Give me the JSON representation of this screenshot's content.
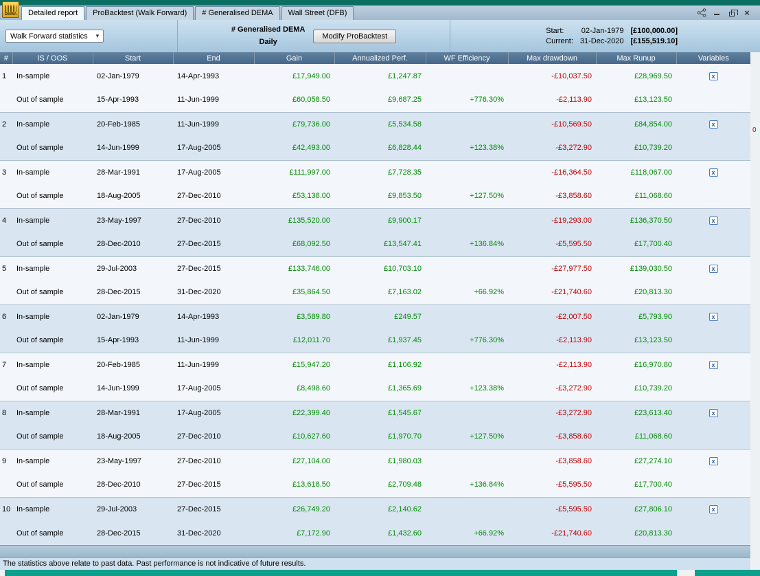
{
  "window": {
    "app_icon_label": "DEMA",
    "tabs": [
      {
        "label": "Detailed report",
        "active": true
      },
      {
        "label": "ProBacktest (Walk Forward)",
        "active": false
      },
      {
        "label": "# Generalised DEMA",
        "active": false
      },
      {
        "label": "Wall Street (DFB)",
        "active": false
      }
    ]
  },
  "icons": {
    "chevron_down": "▾",
    "close": "×",
    "variables_glyph": "x"
  },
  "toolbar": {
    "dropdown_label": "Walk Forward statistics",
    "instrument_title": "# Generalised DEMA",
    "timeframe": "Daily",
    "modify_button": "Modify ProBacktest",
    "start_label": "Start:",
    "start_date": "02-Jan-1979",
    "start_value": "[£100,000.00]",
    "current_label": "Current:",
    "current_date": "31-Dec-2020",
    "current_value": "[£155,519.10]"
  },
  "table": {
    "headers": [
      "#",
      "IS / OOS",
      "Start",
      "End",
      "Gain",
      "Annualized Perf.",
      "WF Efficiency",
      "Max drawdown",
      "Max Runup",
      "Variables"
    ],
    "groups": [
      {
        "num": "1",
        "rows": [
          {
            "type": "In-sample",
            "start": "02-Jan-1979",
            "end": "14-Apr-1993",
            "gain": "£17,949.00",
            "annualized": "£1,247.87",
            "wf": "",
            "drawdown": "-£10,037.50",
            "runup": "£28,969.50"
          },
          {
            "type": "Out of sample",
            "start": "15-Apr-1993",
            "end": "11-Jun-1999",
            "gain": "£60,058.50",
            "annualized": "£9,687.25",
            "wf": "+776.30%",
            "drawdown": "-£2,113.90",
            "runup": "£13,123.50"
          }
        ]
      },
      {
        "num": "2",
        "rows": [
          {
            "type": "In-sample",
            "start": "20-Feb-1985",
            "end": "11-Jun-1999",
            "gain": "£79,736.00",
            "annualized": "£5,534.58",
            "wf": "",
            "drawdown": "-£10,569.50",
            "runup": "£84,854.00"
          },
          {
            "type": "Out of sample",
            "start": "14-Jun-1999",
            "end": "17-Aug-2005",
            "gain": "£42,493.00",
            "annualized": "£6,828.44",
            "wf": "+123.38%",
            "drawdown": "-£3,272.90",
            "runup": "£10,739.20"
          }
        ]
      },
      {
        "num": "3",
        "rows": [
          {
            "type": "In-sample",
            "start": "28-Mar-1991",
            "end": "17-Aug-2005",
            "gain": "£111,997.00",
            "annualized": "£7,728.35",
            "wf": "",
            "drawdown": "-£16,364.50",
            "runup": "£118,067.00"
          },
          {
            "type": "Out of sample",
            "start": "18-Aug-2005",
            "end": "27-Dec-2010",
            "gain": "£53,138.00",
            "annualized": "£9,853.50",
            "wf": "+127.50%",
            "drawdown": "-£3,858.60",
            "runup": "£11,068.60"
          }
        ]
      },
      {
        "num": "4",
        "rows": [
          {
            "type": "In-sample",
            "start": "23-May-1997",
            "end": "27-Dec-2010",
            "gain": "£135,520.00",
            "annualized": "£9,900.17",
            "wf": "",
            "drawdown": "-£19,293.00",
            "runup": "£136,370.50"
          },
          {
            "type": "Out of sample",
            "start": "28-Dec-2010",
            "end": "27-Dec-2015",
            "gain": "£68,092.50",
            "annualized": "£13,547.41",
            "wf": "+136.84%",
            "drawdown": "-£5,595.50",
            "runup": "£17,700.40"
          }
        ]
      },
      {
        "num": "5",
        "rows": [
          {
            "type": "In-sample",
            "start": "29-Jul-2003",
            "end": "27-Dec-2015",
            "gain": "£133,746.00",
            "annualized": "£10,703.10",
            "wf": "",
            "drawdown": "-£27,977.50",
            "runup": "£139,030.50"
          },
          {
            "type": "Out of sample",
            "start": "28-Dec-2015",
            "end": "31-Dec-2020",
            "gain": "£35,864.50",
            "annualized": "£7,163.02",
            "wf": "+66.92%",
            "drawdown": "-£21,740.60",
            "runup": "£20,813.30"
          }
        ]
      },
      {
        "num": "6",
        "rows": [
          {
            "type": "In-sample",
            "start": "02-Jan-1979",
            "end": "14-Apr-1993",
            "gain": "£3,589.80",
            "annualized": "£249.57",
            "wf": "",
            "drawdown": "-£2,007.50",
            "runup": "£5,793.90"
          },
          {
            "type": "Out of sample",
            "start": "15-Apr-1993",
            "end": "11-Jun-1999",
            "gain": "£12,011.70",
            "annualized": "£1,937.45",
            "wf": "+776.30%",
            "drawdown": "-£2,113.90",
            "runup": "£13,123.50"
          }
        ]
      },
      {
        "num": "7",
        "rows": [
          {
            "type": "In-sample",
            "start": "20-Feb-1985",
            "end": "11-Jun-1999",
            "gain": "£15,947.20",
            "annualized": "£1,106.92",
            "wf": "",
            "drawdown": "-£2,113.90",
            "runup": "£16,970.80"
          },
          {
            "type": "Out of sample",
            "start": "14-Jun-1999",
            "end": "17-Aug-2005",
            "gain": "£8,498.60",
            "annualized": "£1,365.69",
            "wf": "+123.38%",
            "drawdown": "-£3,272.90",
            "runup": "£10,739.20"
          }
        ]
      },
      {
        "num": "8",
        "rows": [
          {
            "type": "In-sample",
            "start": "28-Mar-1991",
            "end": "17-Aug-2005",
            "gain": "£22,399.40",
            "annualized": "£1,545.67",
            "wf": "",
            "drawdown": "-£3,272.90",
            "runup": "£23,613.40"
          },
          {
            "type": "Out of sample",
            "start": "18-Aug-2005",
            "end": "27-Dec-2010",
            "gain": "£10,627.60",
            "annualized": "£1,970.70",
            "wf": "+127.50%",
            "drawdown": "-£3,858.60",
            "runup": "£11,068.60"
          }
        ]
      },
      {
        "num": "9",
        "rows": [
          {
            "type": "In-sample",
            "start": "23-May-1997",
            "end": "27-Dec-2010",
            "gain": "£27,104.00",
            "annualized": "£1,980.03",
            "wf": "",
            "drawdown": "-£3,858.60",
            "runup": "£27,274.10"
          },
          {
            "type": "Out of sample",
            "start": "28-Dec-2010",
            "end": "27-Dec-2015",
            "gain": "£13,618.50",
            "annualized": "£2,709.48",
            "wf": "+136.84%",
            "drawdown": "-£5,595.50",
            "runup": "£17,700.40"
          }
        ]
      },
      {
        "num": "10",
        "rows": [
          {
            "type": "In-sample",
            "start": "29-Jul-2003",
            "end": "27-Dec-2015",
            "gain": "£26,749.20",
            "annualized": "£2,140.62",
            "wf": "",
            "drawdown": "-£5,595.50",
            "runup": "£27,806.10"
          },
          {
            "type": "Out of sample",
            "start": "28-Dec-2015",
            "end": "31-Dec-2020",
            "gain": "£7,172.90",
            "annualized": "£1,432.60",
            "wf": "+66.92%",
            "drawdown": "-£21,740.60",
            "runup": "£20,813.30"
          }
        ]
      }
    ]
  },
  "footer": {
    "disclaimer": "The statistics above relate to past data. Past performance is not indicative of future results."
  },
  "background": {
    "chart_axis_value": "0"
  },
  "colors": {
    "positive": "#008a00",
    "negative": "#c00000",
    "header_bg": "#4e6d8d",
    "row_alt_bg": "#d9e6f2"
  }
}
